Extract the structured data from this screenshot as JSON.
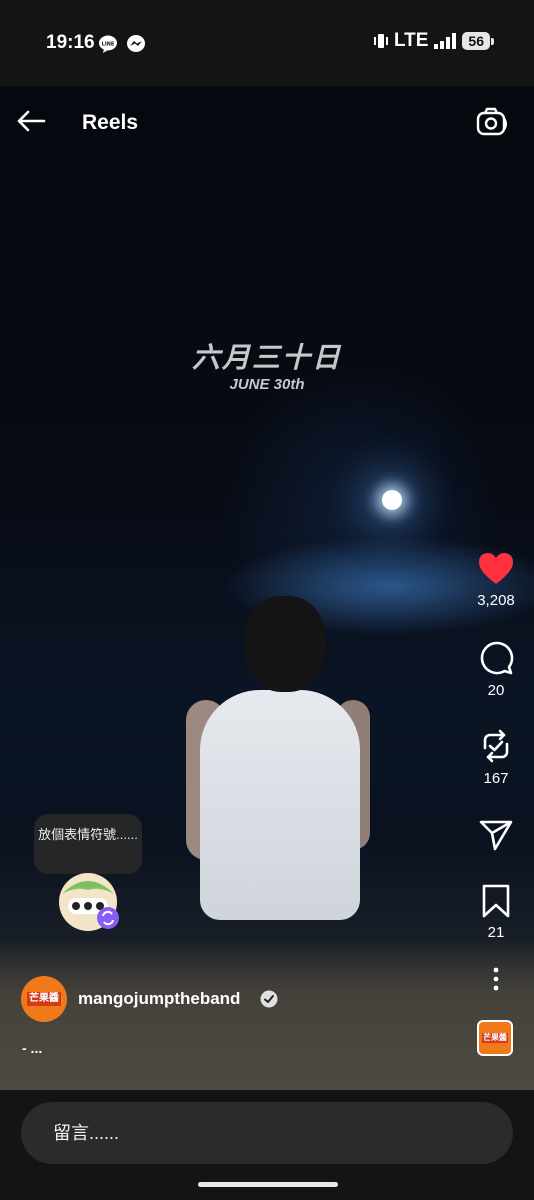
{
  "status_bar": {
    "time": "19:16",
    "network": "LTE",
    "battery": "56"
  },
  "header": {
    "title": "Reels",
    "back_icon": "arrow-left-icon",
    "camera_icon": "camera-icon"
  },
  "video": {
    "title_cn": "六月三十日",
    "title_en": "JUNE 30th"
  },
  "actions": {
    "likes": "3,208",
    "comments": "20",
    "reposts": "167",
    "saves": "21",
    "like_color": "#ff3040"
  },
  "emoji_prompt": "放個表情符號......",
  "author": {
    "username": "mangojumptheband",
    "avatar_text": "芒果醬",
    "verified": true
  },
  "caption": "- ...",
  "comment_box": {
    "placeholder": "留言......"
  }
}
